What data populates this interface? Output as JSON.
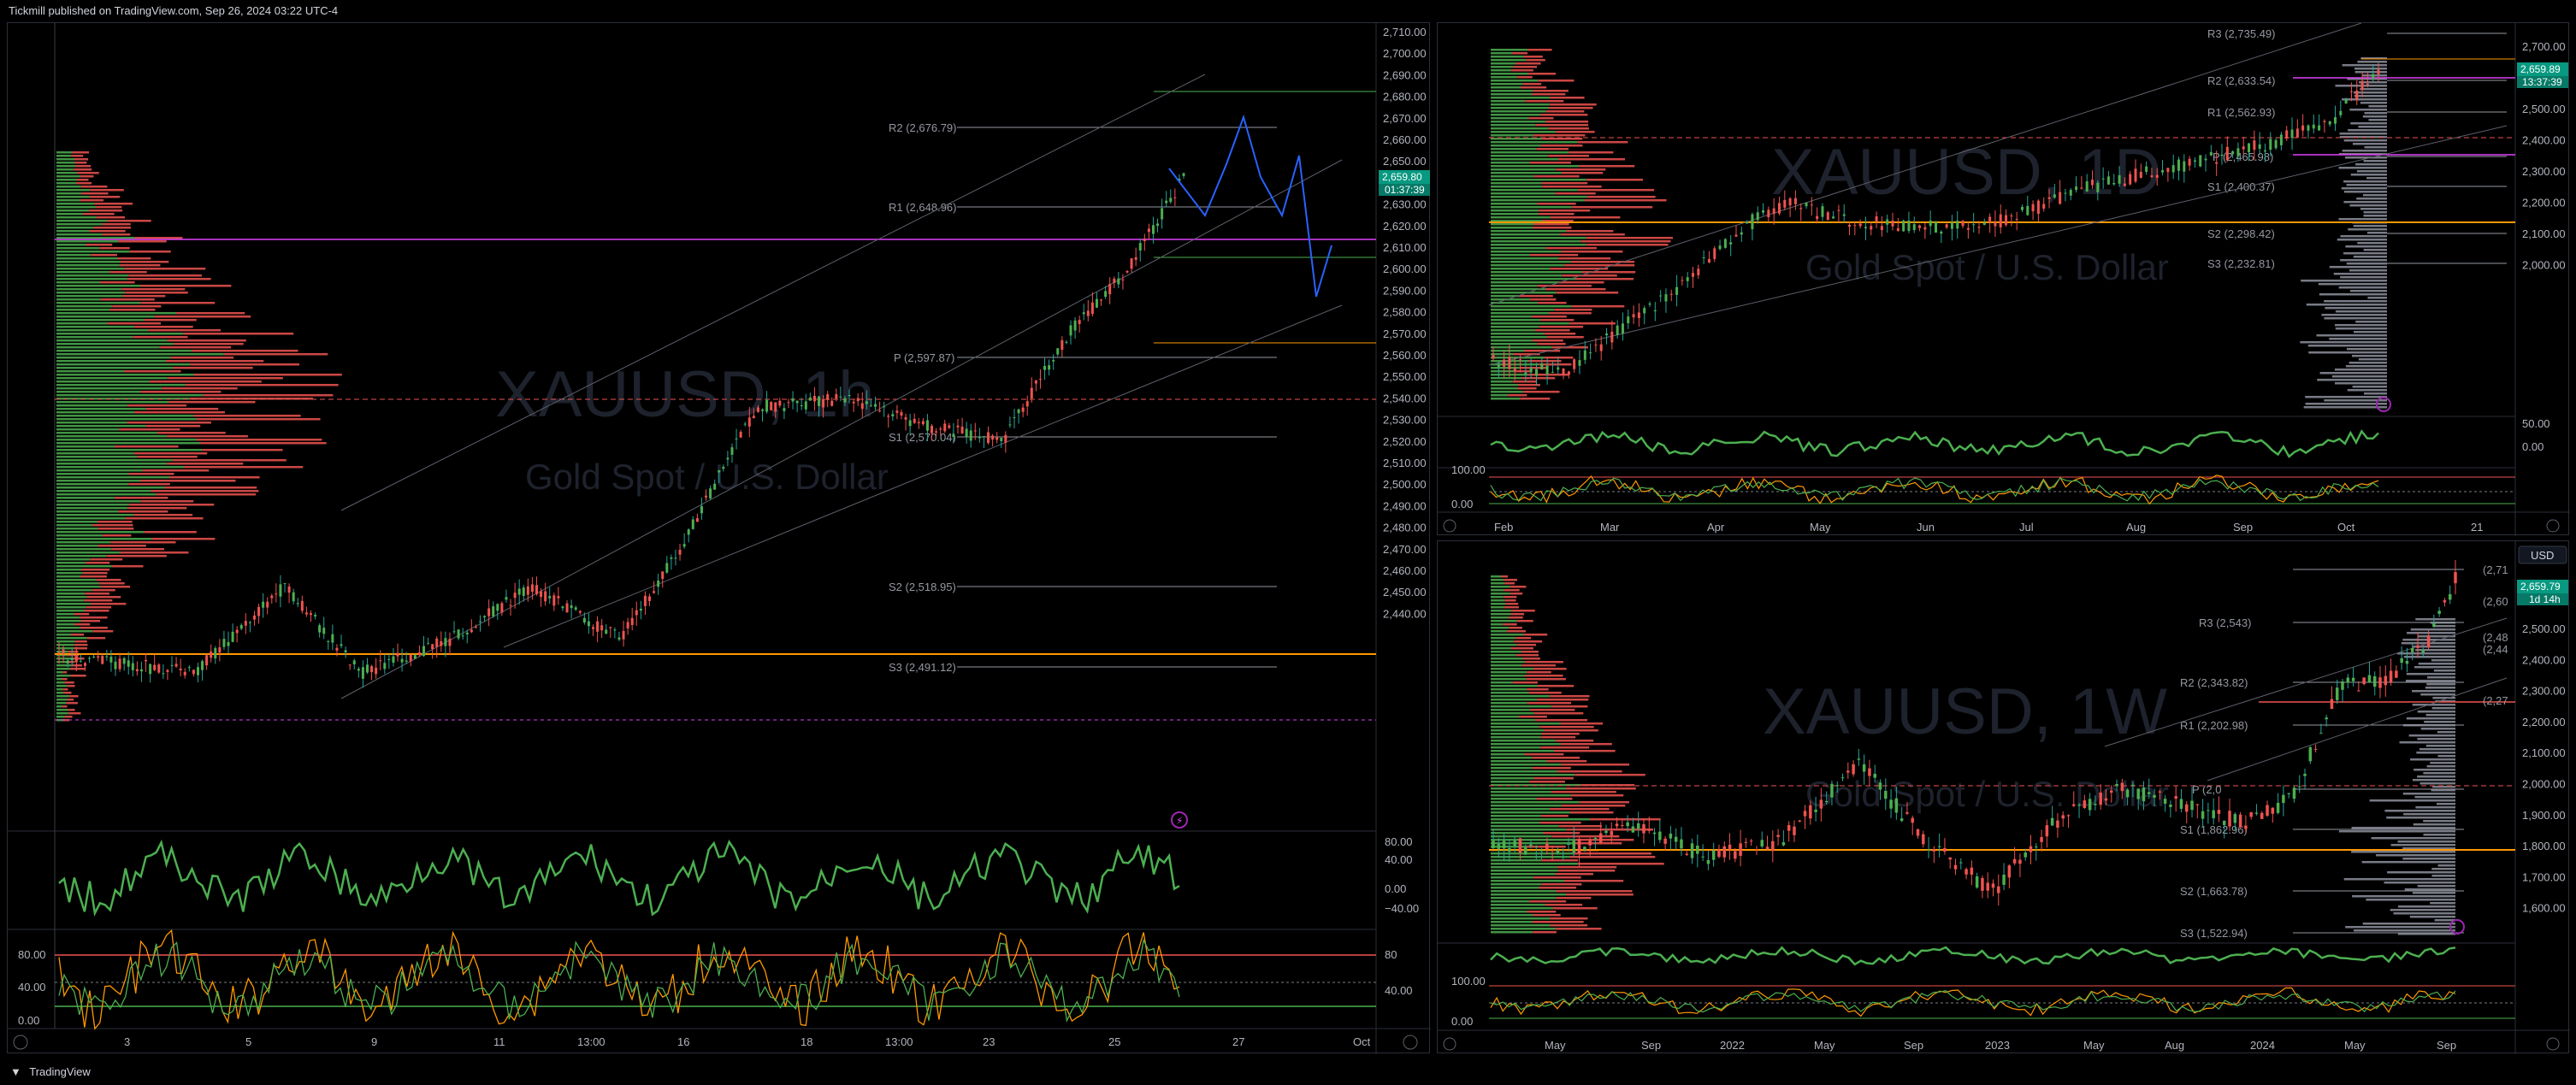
{
  "header": {
    "publisher_text": "Tickmill published on TradingView.com, Sep 26, 2024 03:22 UTC-4"
  },
  "footer": {
    "brand": "TradingView"
  },
  "colors": {
    "up": "#26a69a",
    "down": "#ef5350",
    "green_line": "#4caf50",
    "orange": "#ff9800",
    "magenta": "#e040fb",
    "blue": "#2962ff",
    "price_tag": "#089981"
  },
  "left_chart": {
    "watermark_symbol": "XAUUSD, 1h",
    "watermark_name": "Gold Spot / U.S. Dollar",
    "price_axis": [
      "2,710.00",
      "2,700.00",
      "2,690.00",
      "2,680.00",
      "2,670.00",
      "2,660.00",
      "2,650.00",
      "2,640.00",
      "2,630.00",
      "2,620.00",
      "2,610.00",
      "2,600.00",
      "2,590.00",
      "2,580.00",
      "2,570.00",
      "2,560.00",
      "2,550.00",
      "2,540.00",
      "2,530.00",
      "2,520.00",
      "2,510.00",
      "2,500.00",
      "2,490.00",
      "2,480.00",
      "2,470.00",
      "2,460.00",
      "2,450.00",
      "2,440.00"
    ],
    "last_price": "2,659.80",
    "countdown": "01:37:39",
    "pivots": {
      "r2": "R2 (2,676.79)",
      "r1": "R1 (2,648.96)",
      "p": "P (2,597.87)",
      "s1": "S1 (2,570.04)",
      "s2": "S2 (2,518.95)",
      "s3": "S3 (2,491.12)"
    },
    "time_axis": [
      "3",
      "5",
      "9",
      "11",
      "13:00",
      "16",
      "18",
      "13:00",
      "23",
      "25",
      "27",
      "Oct"
    ],
    "rsi_axis": [
      "80.00",
      "40.00",
      "0.00",
      "−40.00"
    ],
    "stoch_axis_left": [
      "80.00",
      "40.00",
      "0.00"
    ],
    "stoch_axis_right": [
      "80",
      "40.00"
    ]
  },
  "top_right_chart": {
    "watermark_symbol": "XAUUSD, 1D",
    "watermark_name": "Gold Spot / U.S. Dollar",
    "price_axis": [
      "2,700.00",
      "2,600.00",
      "2,500.00",
      "2,400.00",
      "2,300.00",
      "2,200.00",
      "2,100.00",
      "2,000.00"
    ],
    "last_price": "2,659.89",
    "countdown": "13:37:39",
    "pivots": {
      "r3": "R3 (2,735.49)",
      "r2": "R2 (2,633.54)",
      "r1": "R1 (2,562.93)",
      "p": "P (2,465.98)",
      "s1": "S1 (2,400.37)",
      "s2": "S2 (2,298.42)",
      "s3": "S3 (2,232.81)"
    },
    "time_axis": [
      "Feb",
      "Mar",
      "Apr",
      "May",
      "Jun",
      "Jul",
      "Aug",
      "Sep",
      "Oct",
      "21"
    ],
    "rsi_axis": [
      "50.00",
      "0.00"
    ],
    "stoch_axis": [
      "100.00",
      "0.00"
    ]
  },
  "bottom_right_chart": {
    "watermark_symbol": "XAUUSD, 1W",
    "watermark_name": "Gold Spot / U.S. Dollar",
    "currency_button": "USD",
    "price_axis": [
      "2,500.00",
      "2,400.00",
      "2,300.00",
      "2,200.00",
      "2,100.00",
      "2,000.00",
      "1,900.00",
      "1,800.00",
      "1,700.00",
      "1,600.00"
    ],
    "last_price": "2,659.79",
    "countdown": "1d 14h",
    "pivots": {
      "r3": "R3 (2,543)",
      "r2": "R2 (2,343.82)",
      "r1": "R1 (2,202.98)",
      "p": "P (2,0",
      "s1": "S1 (1,862.96)",
      "s2": "S2 (1,663.78)",
      "s3": "S3 (1,522.94)"
    },
    "right_labels": [
      "(2,71",
      "(2,60",
      "(2,48",
      "(2,44",
      "(2,27"
    ],
    "time_axis": [
      "May",
      "Sep",
      "2022",
      "May",
      "Sep",
      "2023",
      "May",
      "Aug",
      "2024",
      "May",
      "Sep"
    ],
    "stoch_axis": [
      "100.00",
      "0.00"
    ]
  }
}
